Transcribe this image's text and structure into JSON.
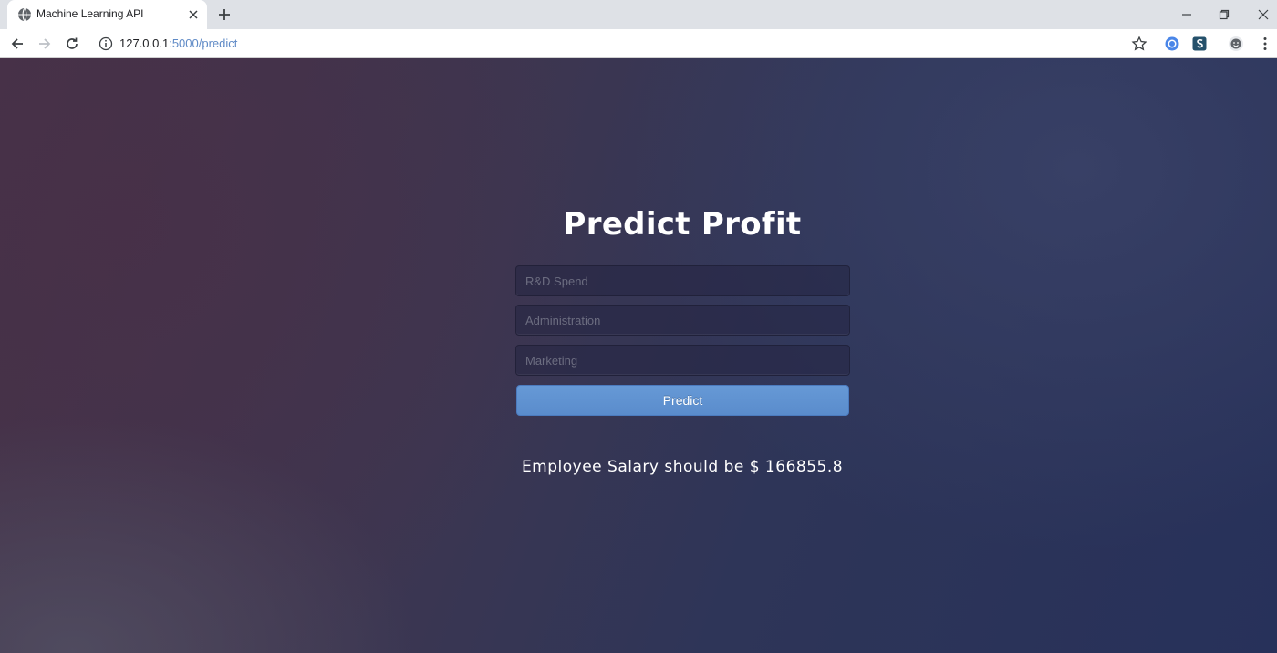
{
  "browser": {
    "tab_title": "Machine Learning API",
    "url_host": "127.0.0.1",
    "url_path": ":5000/predict"
  },
  "page": {
    "title": "Predict Profit",
    "fields": [
      {
        "placeholder": "R&D Spend",
        "value": ""
      },
      {
        "placeholder": "Administration",
        "value": ""
      },
      {
        "placeholder": "Marketing",
        "value": ""
      }
    ],
    "button_label": "Predict",
    "result_text": "Employee Salary should be $ 166855.8"
  }
}
